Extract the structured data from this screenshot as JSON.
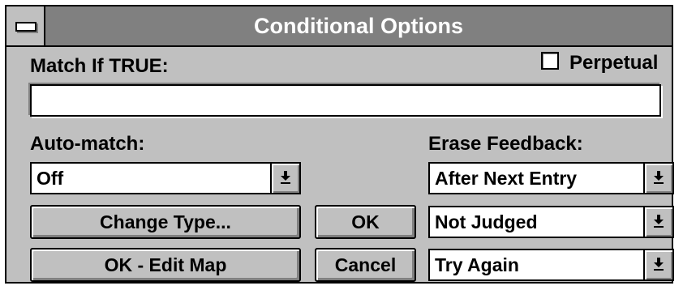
{
  "window": {
    "title": "Conditional Options",
    "system_menu_icon": "system-menu-dash"
  },
  "match": {
    "label": "Match If TRUE:",
    "value": ""
  },
  "perpetual": {
    "label": "Perpetual",
    "checked": false
  },
  "auto_match": {
    "label": "Auto-match:",
    "selected": "Off"
  },
  "erase_feedback": {
    "label": "Erase Feedback:",
    "selected": "After Next Entry"
  },
  "judging": {
    "selected": "Not Judged"
  },
  "retry": {
    "selected": "Try Again"
  },
  "buttons": {
    "change_type": "Change Type...",
    "ok_edit_map": "OK - Edit Map",
    "ok": "OK",
    "cancel": "Cancel"
  },
  "icons": {
    "dropdown": "dropdown-arrow-icon"
  }
}
